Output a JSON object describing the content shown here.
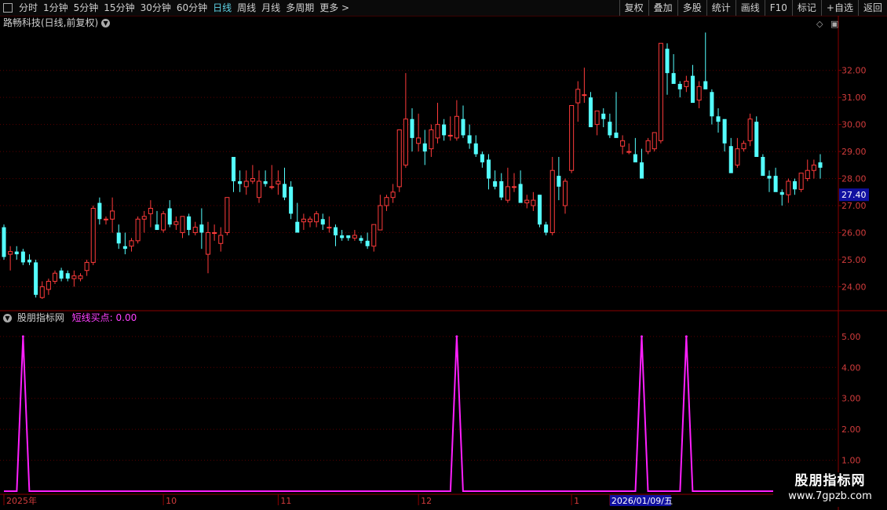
{
  "toolbar": {
    "periods": [
      "分时",
      "1分钟",
      "5分钟",
      "15分钟",
      "30分钟",
      "60分钟",
      "日线",
      "周线",
      "月线",
      "多周期",
      "更多 >"
    ],
    "active_period": "日线",
    "tools": [
      "复权",
      "叠加",
      "多股",
      "统计",
      "画线",
      "F10",
      "标记",
      "+自选",
      "返回"
    ]
  },
  "main_panel": {
    "title": "路畅科技(日线,前复权)",
    "last_price_label": "27.40"
  },
  "indicator_panel": {
    "title": "股朋指标网",
    "indicator_label": "短线买点: 0.00"
  },
  "watermark": {
    "line1": "股朋指标网",
    "line2": "www.7gpzb.com"
  },
  "colors": {
    "up": "#ff3b3b",
    "down": "#54ffff",
    "indicator": "#ff20ff",
    "grid": "#5a0000"
  },
  "chart_data": [
    {
      "type": "candlestick",
      "title": "路畅科技(日线,前复权)",
      "y_ticks": [
        24.0,
        25.0,
        26.0,
        27.0,
        28.0,
        29.0,
        30.0,
        31.0,
        32.0
      ],
      "ylim": [
        23.2,
        33.5
      ],
      "grid": true,
      "candles": [
        [
          26.2,
          26.3,
          25.0,
          25.1
        ],
        [
          25.2,
          25.5,
          24.6,
          25.3
        ],
        [
          25.3,
          25.5,
          25.0,
          25.2
        ],
        [
          25.3,
          25.4,
          24.8,
          24.9
        ],
        [
          25.0,
          25.2,
          24.8,
          24.9
        ],
        [
          24.9,
          25.0,
          23.6,
          23.7
        ],
        [
          23.6,
          24.2,
          23.55,
          24.0
        ],
        [
          23.9,
          24.3,
          23.7,
          24.2
        ],
        [
          24.2,
          24.6,
          24.1,
          24.5
        ],
        [
          24.6,
          24.7,
          24.2,
          24.3
        ],
        [
          24.5,
          24.6,
          24.2,
          24.3
        ],
        [
          24.3,
          24.6,
          24.0,
          24.4
        ],
        [
          24.3,
          24.5,
          24.2,
          24.4
        ],
        [
          24.6,
          25.0,
          24.4,
          24.9
        ],
        [
          24.9,
          27.0,
          24.8,
          26.9
        ],
        [
          27.1,
          27.3,
          26.3,
          26.5
        ],
        [
          26.5,
          26.6,
          26.3,
          26.5
        ],
        [
          26.5,
          27.3,
          26.0,
          26.8
        ],
        [
          26.0,
          26.3,
          25.4,
          25.6
        ],
        [
          25.5,
          26.0,
          25.2,
          25.4
        ],
        [
          25.5,
          25.8,
          25.3,
          25.7
        ],
        [
          25.7,
          26.6,
          25.6,
          26.5
        ],
        [
          26.5,
          26.8,
          26.0,
          26.6
        ],
        [
          26.7,
          27.2,
          26.2,
          26.9
        ],
        [
          26.3,
          26.8,
          26.1,
          26.1
        ],
        [
          26.1,
          26.8,
          26.0,
          26.7
        ],
        [
          26.9,
          27.2,
          26.2,
          26.3
        ],
        [
          26.3,
          26.6,
          26.1,
          26.4
        ],
        [
          26.0,
          26.6,
          25.8,
          26.6
        ],
        [
          26.6,
          26.7,
          25.9,
          26.1
        ],
        [
          26.0,
          26.4,
          25.9,
          26.2
        ],
        [
          26.3,
          26.9,
          25.4,
          26.0
        ],
        [
          25.2,
          26.4,
          24.5,
          26.0
        ],
        [
          26.0,
          26.3,
          25.7,
          26.0
        ],
        [
          25.6,
          26.2,
          25.3,
          25.9
        ],
        [
          26.0,
          27.3,
          25.9,
          27.3
        ],
        [
          28.8,
          28.8,
          27.5,
          27.9
        ],
        [
          27.9,
          28.3,
          27.5,
          27.8
        ],
        [
          27.7,
          28.3,
          27.4,
          27.9
        ],
        [
          27.9,
          28.5,
          27.8,
          28.0
        ],
        [
          27.3,
          28.3,
          27.1,
          27.9
        ],
        [
          27.9,
          28.3,
          27.7,
          27.8
        ],
        [
          27.7,
          28.5,
          27.6,
          27.7
        ],
        [
          27.8,
          28.3,
          27.4,
          27.9
        ],
        [
          27.8,
          28.4,
          27.2,
          27.3
        ],
        [
          27.7,
          27.9,
          26.5,
          26.7
        ],
        [
          26.4,
          27.1,
          26.0,
          26.0
        ],
        [
          26.4,
          26.7,
          26.1,
          26.5
        ],
        [
          26.4,
          26.6,
          26.2,
          26.5
        ],
        [
          26.4,
          26.8,
          26.2,
          26.7
        ],
        [
          26.5,
          26.7,
          26.1,
          26.3
        ],
        [
          26.2,
          26.6,
          26.0,
          26.2
        ],
        [
          26.2,
          26.3,
          25.5,
          25.9
        ],
        [
          25.9,
          26.1,
          25.7,
          25.8
        ],
        [
          25.9,
          25.9,
          25.7,
          25.8
        ],
        [
          25.8,
          26.1,
          25.7,
          25.9
        ],
        [
          25.8,
          25.9,
          25.6,
          25.7
        ],
        [
          25.7,
          26.0,
          25.4,
          25.5
        ],
        [
          25.5,
          26.3,
          25.3,
          26.3
        ],
        [
          26.1,
          27.4,
          26.1,
          27.0
        ],
        [
          27.0,
          27.4,
          26.8,
          27.3
        ],
        [
          27.3,
          27.8,
          27.1,
          27.5
        ],
        [
          27.7,
          29.8,
          27.5,
          29.8
        ],
        [
          28.5,
          31.9,
          28.4,
          30.2
        ],
        [
          30.2,
          30.6,
          29.0,
          29.5
        ],
        [
          29.3,
          30.4,
          29.0,
          29.5
        ],
        [
          29.3,
          29.8,
          28.5,
          29.0
        ],
        [
          29.1,
          30.0,
          28.8,
          29.8
        ],
        [
          29.5,
          30.8,
          29.3,
          30.0
        ],
        [
          30.0,
          30.2,
          29.4,
          29.6
        ],
        [
          29.6,
          30.3,
          29.4,
          29.6
        ],
        [
          29.5,
          30.9,
          29.4,
          30.3
        ],
        [
          30.2,
          30.7,
          29.5,
          29.6
        ],
        [
          29.6,
          30.0,
          29.1,
          29.3
        ],
        [
          29.3,
          29.6,
          28.8,
          28.9
        ],
        [
          28.9,
          29.0,
          28.4,
          28.6
        ],
        [
          28.7,
          28.9,
          27.6,
          28.0
        ],
        [
          27.9,
          28.3,
          27.6,
          27.7
        ],
        [
          27.9,
          28.2,
          27.2,
          27.3
        ],
        [
          27.2,
          28.4,
          27.1,
          27.7
        ],
        [
          27.7,
          28.2,
          27.5,
          27.7
        ],
        [
          27.8,
          28.3,
          27.3,
          27.1
        ],
        [
          27.1,
          27.4,
          26.9,
          27.2
        ],
        [
          27.0,
          27.5,
          26.8,
          27.2
        ],
        [
          27.4,
          27.4,
          26.2,
          26.3
        ],
        [
          26.3,
          26.4,
          25.9,
          26.0
        ],
        [
          26.0,
          28.8,
          25.9,
          28.3
        ],
        [
          28.1,
          28.8,
          27.2,
          27.7
        ],
        [
          27.0,
          28.0,
          26.7,
          27.9
        ],
        [
          28.3,
          30.7,
          28.2,
          30.7
        ],
        [
          30.8,
          31.6,
          30.1,
          31.3
        ],
        [
          31.1,
          32.1,
          30.8,
          31.1
        ],
        [
          31.0,
          31.2,
          30.1,
          29.9
        ],
        [
          30.0,
          30.4,
          29.6,
          30.5
        ],
        [
          30.4,
          30.6,
          29.9,
          30.2
        ],
        [
          30.1,
          30.4,
          29.5,
          29.6
        ],
        [
          29.7,
          31.2,
          29.6,
          29.5
        ],
        [
          29.2,
          29.6,
          28.9,
          29.4
        ],
        [
          29.0,
          29.3,
          28.9,
          29.0
        ],
        [
          28.9,
          29.5,
          28.7,
          28.6
        ],
        [
          28.6,
          29.1,
          28.4,
          28.0
        ],
        [
          29.0,
          29.5,
          28.9,
          29.4
        ],
        [
          29.1,
          29.7,
          29.0,
          29.7
        ],
        [
          29.4,
          30.5,
          29.3,
          33.0
        ],
        [
          32.8,
          33.0,
          31.1,
          31.9
        ],
        [
          31.9,
          32.6,
          31.6,
          31.5
        ],
        [
          31.5,
          31.6,
          31.0,
          31.3
        ],
        [
          31.4,
          31.8,
          31.2,
          31.6
        ],
        [
          31.8,
          32.2,
          30.9,
          30.8
        ],
        [
          30.9,
          31.6,
          30.6,
          31.4
        ],
        [
          31.6,
          33.4,
          31.3,
          31.3
        ],
        [
          31.2,
          31.3,
          30.0,
          30.3
        ],
        [
          30.3,
          30.6,
          29.7,
          30.1
        ],
        [
          30.2,
          29.7,
          29.0,
          29.3
        ],
        [
          29.2,
          29.5,
          28.6,
          28.2
        ],
        [
          28.5,
          29.5,
          28.4,
          29.1
        ],
        [
          29.1,
          29.4,
          29.0,
          29.3
        ],
        [
          29.4,
          30.4,
          29.2,
          30.2
        ],
        [
          30.1,
          30.3,
          29.6,
          28.8
        ],
        [
          28.8,
          28.9,
          28.3,
          28.1
        ],
        [
          28.1,
          28.3,
          27.5,
          28.0
        ],
        [
          28.1,
          28.4,
          27.8,
          27.5
        ],
        [
          27.5,
          27.6,
          27.0,
          27.4
        ],
        [
          27.4,
          28.0,
          27.1,
          27.9
        ],
        [
          27.9,
          28.0,
          27.4,
          27.6
        ],
        [
          27.6,
          28.1,
          27.5,
          28.2
        ],
        [
          28.0,
          28.7,
          27.9,
          28.3
        ],
        [
          28.3,
          28.7,
          28.0,
          28.5
        ],
        [
          28.6,
          28.9,
          28.0,
          28.4
        ]
      ]
    },
    {
      "type": "line",
      "title": "股朋指标网",
      "series": [
        {
          "name": "短线买点",
          "peak_indices": [
            3,
            71,
            100,
            107
          ],
          "peak_value": 5.0,
          "base_value": 0.0
        }
      ],
      "y_ticks": [
        1.0,
        2.0,
        3.0,
        4.0,
        5.0
      ],
      "ylim": [
        0,
        5.3
      ],
      "x_labels": [
        {
          "text": "2025年",
          "index": 0
        },
        {
          "text": "10",
          "index": 25
        },
        {
          "text": "11",
          "index": 43
        },
        {
          "text": "12",
          "index": 65
        },
        {
          "text": "1",
          "index": 89
        },
        {
          "text": "2026/01/09/五",
          "index": 95
        }
      ]
    }
  ]
}
